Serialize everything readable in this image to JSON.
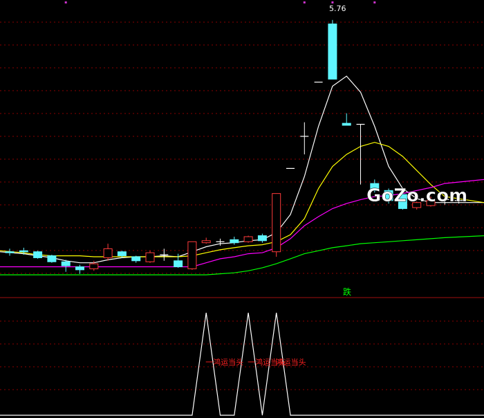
{
  "chart_data": [
    {
      "type": "candlestick",
      "panel": "main",
      "annotations": {
        "high_label": "5.76",
        "signal_label": "跌",
        "watermark": "GoZo.com"
      },
      "colors": {
        "bull": "#ff3b3b",
        "bear": "#5ff5ff",
        "doji": "#ffffff",
        "ma_white": "#ffffff",
        "ma_yellow": "#ffff00",
        "ma_magenta": "#ff00ff",
        "ma_green": "#00ff00",
        "grid": "#8b0000",
        "marker": "#cc33cc"
      },
      "ylim": [
        0,
        100
      ],
      "candles": [
        {
          "o": 12.5,
          "c": 12.0,
          "h": 14.0,
          "l": 10.5
        },
        {
          "o": 13.0,
          "c": 12.5,
          "h": 14.5,
          "l": 11.0
        },
        {
          "o": 12.5,
          "c": 9.5,
          "h": 13.0,
          "l": 9.0
        },
        {
          "o": 10.5,
          "c": 7.5,
          "h": 11.0,
          "l": 7.0
        },
        {
          "o": 7.5,
          "c": 5.5,
          "h": 8.5,
          "l": 2.5
        },
        {
          "o": 5.0,
          "c": 3.5,
          "h": 6.0,
          "l": 1.5
        },
        {
          "o": 4.0,
          "c": 6.5,
          "h": 8.0,
          "l": 3.0
        },
        {
          "o": 9.5,
          "c": 14.0,
          "h": 16.5,
          "l": 8.0
        },
        {
          "o": 12.5,
          "c": 10.5,
          "h": 13.0,
          "l": 9.5
        },
        {
          "o": 10.0,
          "c": 8.0,
          "h": 10.5,
          "l": 7.0
        },
        {
          "o": 7.5,
          "c": 12.0,
          "h": 13.0,
          "l": 7.0
        },
        {
          "o": 11.0,
          "c": 11.0,
          "h": 14.0,
          "l": 8.0
        },
        {
          "o": 8.0,
          "c": 5.0,
          "h": 11.5,
          "l": 4.5
        },
        {
          "o": 4.0,
          "c": 17.5,
          "h": 17.5,
          "l": 3.5
        },
        {
          "o": 17.0,
          "c": 18.0,
          "h": 19.5,
          "l": 16.5
        },
        {
          "o": 17.5,
          "c": 17.5,
          "h": 19.0,
          "l": 15.5
        },
        {
          "o": 18.5,
          "c": 17.0,
          "h": 20.0,
          "l": 16.0
        },
        {
          "o": 17.5,
          "c": 20.0,
          "h": 20.5,
          "l": 17.0
        },
        {
          "o": 20.5,
          "c": 18.0,
          "h": 21.5,
          "l": 17.0
        },
        {
          "o": 12.5,
          "c": 41.5,
          "h": 41.5,
          "l": 10.0
        },
        {
          "o": 54.0,
          "c": 54.0,
          "h": 54.0,
          "l": 54.0
        },
        {
          "o": 70.0,
          "c": 70.0,
          "h": 77.0,
          "l": 61.0
        },
        {
          "o": 97.0,
          "c": 97.0,
          "h": 97.0,
          "l": 97.0
        },
        {
          "o": 126.0,
          "c": 98.5,
          "h": 128.0,
          "l": 98.5
        },
        {
          "o": 76.5,
          "c": 75.5,
          "h": 81.5,
          "l": 75.5
        },
        {
          "o": 76.0,
          "c": 76.0,
          "h": 76.0,
          "l": 46.0
        },
        {
          "o": 46.5,
          "c": 43.0,
          "h": 48.5,
          "l": 42.0
        },
        {
          "o": 43.0,
          "c": 38.0,
          "h": 44.0,
          "l": 36.5
        },
        {
          "o": 41.0,
          "c": 34.0,
          "h": 41.5,
          "l": 33.5
        },
        {
          "o": 34.5,
          "c": 37.0,
          "h": 37.5,
          "l": 33.5
        },
        {
          "o": 35.5,
          "c": 38.0,
          "h": 40.0,
          "l": 35.0
        },
        {
          "o": 38.5,
          "c": 38.5,
          "h": 40.0,
          "l": 36.0
        },
        {
          "o": 38.0,
          "c": 38.0,
          "h": 39.0,
          "l": 36.5
        }
      ],
      "series": [
        {
          "values": [
            12.5,
            11.5,
            10.5,
            9.5,
            8.0,
            7.0,
            7.0,
            8.5,
            9.5,
            10.0,
            10.0,
            10.5,
            10.0,
            12.5,
            15.0,
            16.5,
            17.0,
            18.0,
            18.5,
            22.0,
            31.0,
            50.0,
            75.0,
            95.0,
            100.0,
            92.0,
            75.0,
            55.0,
            44.0,
            39.0,
            37.0,
            37.0,
            37.0
          ]
        },
        {
          "values": [
            13.0,
            12.0,
            11.0,
            10.5,
            10.5,
            10.5,
            10.0,
            10.0,
            10.0,
            10.0,
            10.0,
            10.0,
            10.0,
            10.5,
            12.0,
            13.5,
            14.5,
            15.5,
            16.0,
            17.5,
            21.0,
            29.0,
            44.0,
            55.0,
            61.0,
            65.0,
            67.0,
            65.0,
            60.0,
            53.0,
            46.0,
            40.0,
            37.0
          ]
        },
        {
          "values": [
            5.0,
            5.0,
            5.0,
            5.0,
            5.0,
            5.0,
            5.0,
            5.0,
            5.0,
            5.0,
            5.0,
            5.0,
            5.0,
            5.0,
            7.0,
            9.0,
            10.0,
            11.5,
            12.0,
            14.5,
            19.0,
            25.5,
            30.0,
            34.0,
            36.5,
            38.5,
            40.0,
            40.5,
            41.5,
            43.0,
            44.5,
            46.5,
            48.5
          ]
        },
        {
          "values": [
            1.0,
            1.0,
            1.0,
            1.0,
            1.0,
            1.0,
            1.0,
            1.0,
            1.0,
            1.0,
            1.0,
            1.0,
            1.0,
            1.0,
            1.0,
            1.5,
            2.0,
            3.0,
            4.5,
            6.5,
            9.0,
            11.5,
            13.0,
            14.5,
            15.5,
            16.5,
            17.0,
            17.5,
            18.0,
            18.5,
            19.0,
            19.5,
            20.5
          ]
        }
      ],
      "markers": [
        {
          "index": 4
        },
        {
          "index": 21
        },
        {
          "index": 23
        },
        {
          "index": 26
        }
      ]
    },
    {
      "type": "line",
      "panel": "indicator",
      "ylim": [
        0,
        100
      ],
      "values": [
        0,
        0,
        0,
        0,
        0,
        0,
        0,
        0,
        0,
        0,
        0,
        0,
        0,
        0,
        100,
        0,
        0,
        100,
        0,
        100,
        0,
        0,
        0,
        0,
        0,
        0,
        0,
        0,
        0,
        0,
        0,
        0,
        0
      ],
      "labels": [
        {
          "index": 14,
          "text": "一鸿运当头"
        },
        {
          "index": 17,
          "text": "一鸿运当头"
        },
        {
          "index": 19,
          "text": "鸿运当头"
        }
      ],
      "label_color": "#ff2020",
      "line_color": "#ffffff"
    }
  ]
}
